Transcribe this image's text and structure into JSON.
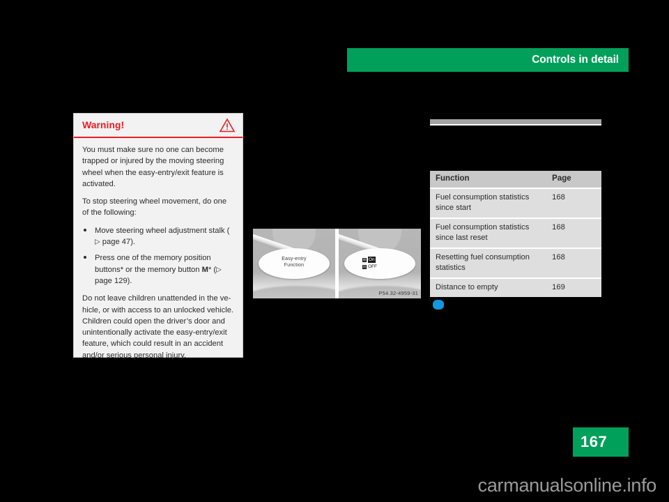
{
  "chapter": {
    "title": "Controls in detail"
  },
  "warning": {
    "title": "Warning!",
    "icon": "warning-triangle-icon",
    "accent_color": "#ed1c24",
    "paragraphs": {
      "intro": "You must make sure no one can become trapped or injured by the moving steering wheel when the easy-entry/exit feature is activated.",
      "instruction": "To stop steering wheel movement, do one of the following:",
      "closing": "Do not leave children unattended in the ve-hicle, or with access to an unlocked vehicle. Children could open the driver’s door and unintentionally activate the easy-entry/exit feature, which could result in an accident and/or serious personal injury."
    },
    "bullets": [
      {
        "text_before": "Move steering wheel adjustment stalk (",
        "ref_arrow": "▷",
        "ref_text": " page 47",
        "text_after": ")."
      },
      {
        "text_before": "Press one of the memory position buttons* or the memory button ",
        "bold_token": "M",
        "text_mid": "* (",
        "ref_arrow": "▷",
        "ref_text": " page 129",
        "text_after": ")."
      }
    ]
  },
  "figure": {
    "caption": "P54.32-4959-31",
    "left_pane": {
      "display_line1": "Easy-entry",
      "display_line2": "Function"
    },
    "right_pane": {
      "menu": [
        {
          "icon": "⊞",
          "label": "On",
          "selected": true
        },
        {
          "icon": "⊟",
          "label": "OFF",
          "selected": false
        }
      ]
    }
  },
  "table": {
    "headers": {
      "function": "Function",
      "page": "Page"
    },
    "rows": [
      {
        "function": "Fuel consumption statistics since start",
        "page": "168"
      },
      {
        "function": "Fuel consumption statistics since last reset",
        "page": "168"
      },
      {
        "function": "Resetting fuel consumption statistics",
        "page": "168"
      },
      {
        "function": "Distance to empty",
        "page": "169"
      }
    ]
  },
  "folio": {
    "page_number": "167",
    "color": "#00a05a"
  },
  "watermark": {
    "text": "carmanualsonline.info"
  }
}
